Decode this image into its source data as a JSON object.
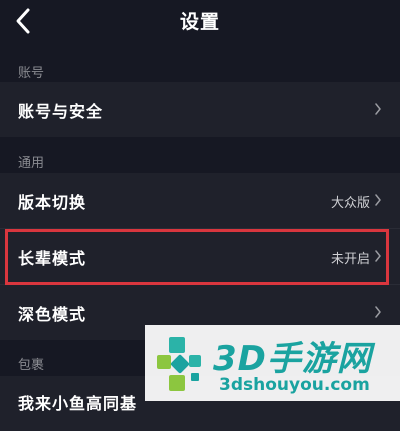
{
  "header": {
    "title": "设置",
    "back_icon": "chevron-left-icon"
  },
  "sections": [
    {
      "label": "账号",
      "items": [
        {
          "label": "账号与安全",
          "value": ""
        }
      ]
    },
    {
      "label": "通用",
      "items": [
        {
          "label": "版本切换",
          "value": "大众版"
        },
        {
          "label": "长辈模式",
          "value": "未开启"
        },
        {
          "label": "深色模式",
          "value": ""
        }
      ]
    },
    {
      "label": "包裹",
      "items": [
        {
          "label": "我来小鱼高同基",
          "value": ""
        }
      ]
    }
  ],
  "colors": {
    "background": "#161823",
    "row_background": "#1f212b",
    "highlight_border": "#d9363e",
    "watermark_accent": "#1aa3a0"
  },
  "watermark": {
    "brand": "3D手游网",
    "url": "3dshouyou.com"
  }
}
